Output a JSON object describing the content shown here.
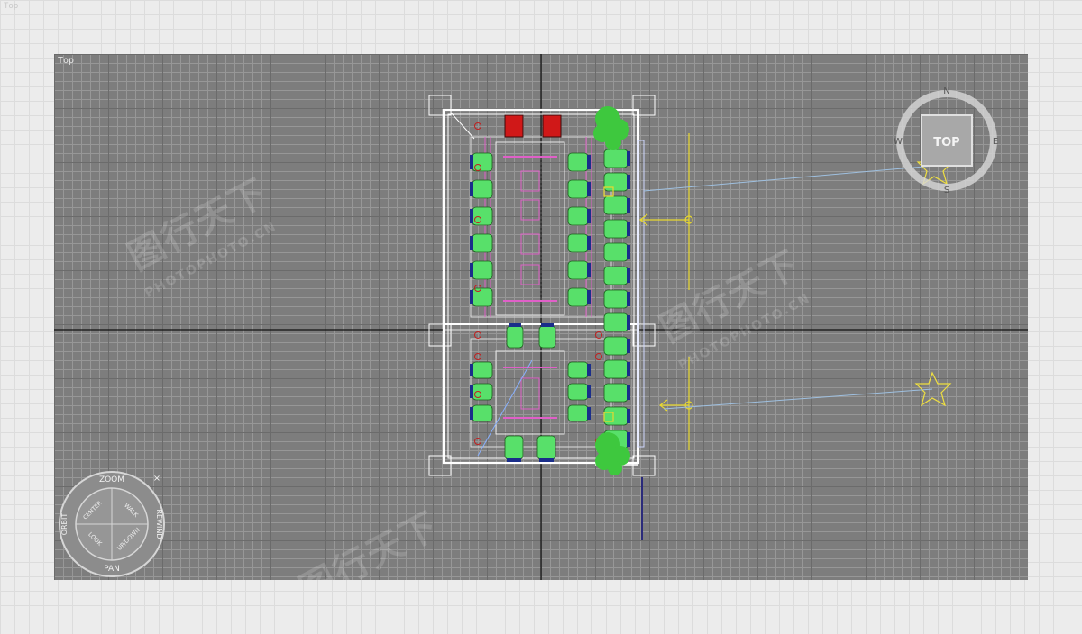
{
  "background_label": "Top",
  "viewport": {
    "label": "Top"
  },
  "viewcube": {
    "face_label": "TOP",
    "compass": [
      "N",
      "E",
      "S",
      "W"
    ]
  },
  "steering_wheel": {
    "top": "ZOOM",
    "left": "ORBIT",
    "right": "REWIND",
    "bottom": "PAN",
    "inner_top_left": "CENTER",
    "inner_top_right": "WALK",
    "inner_bottom_left": "LOOK",
    "inner_bottom_right": "UP/DOWN",
    "close": "×"
  },
  "watermark": {
    "brand": "图行天下",
    "url": "PHOTOPHOTO.CN"
  },
  "colors": {
    "viewport_bg": "#7d7d7d",
    "walls": "#ffffff",
    "chair": "#58e06a",
    "chair_back": "#1a2e8a",
    "table_line": "#e060c8",
    "light": "#f0e040",
    "plant": "#3ec83e",
    "red_chair": "#d01818"
  }
}
